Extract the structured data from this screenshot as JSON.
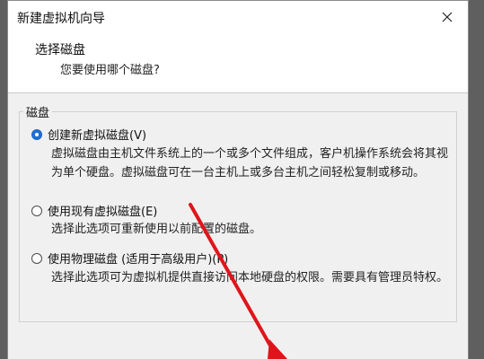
{
  "window": {
    "title": "新建虚拟机向导"
  },
  "header": {
    "title": "选择磁盘",
    "subtitle": "您要使用哪个磁盘?"
  },
  "group": {
    "legend": "磁盘",
    "options": [
      {
        "label": "创建新虚拟磁盘(V)",
        "selected": true,
        "desc": "虚拟磁盘由主机文件系统上的一个或多个文件组成，客户机操作系统会将其视为单个硬盘。虚拟磁盘可在一台主机上或多台主机之间轻松复制或移动。"
      },
      {
        "label": "使用现有虚拟磁盘(E)",
        "selected": false,
        "desc": "选择此选项可重新使用以前配置的磁盘。"
      },
      {
        "label": "使用物理磁盘 (适用于高级用户)(P)",
        "selected": false,
        "desc": "选择此选项可为虚拟机提供直接访问本地硬盘的权限。需要具有管理员特权。"
      }
    ]
  },
  "colors": {
    "accent": "#1f6fd6",
    "annotation_arrow": "#e0141b"
  },
  "icons": {
    "close": "close-icon"
  }
}
